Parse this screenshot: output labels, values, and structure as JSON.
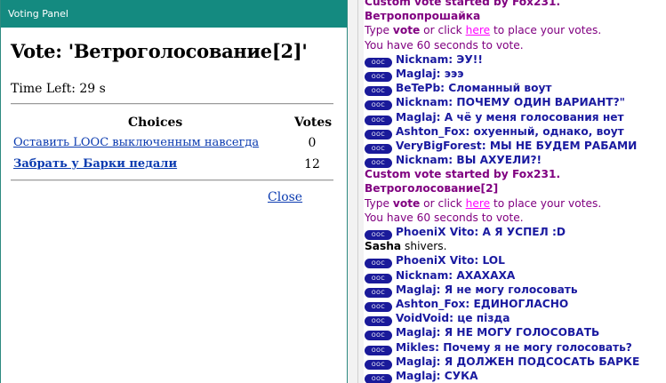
{
  "window": {
    "title": "Voting Panel"
  },
  "vote": {
    "title": "Vote: 'Ветроголосование[2]'",
    "time_left": "Time Left: 29 s",
    "col_choices": "Choices",
    "col_votes": "Votes",
    "choices": [
      {
        "label": "Оставить LOOC выключенным навсегда",
        "votes": "0"
      },
      {
        "label": "Забрать у Барки педали",
        "votes": "12"
      }
    ],
    "close_label": "Close"
  },
  "chat": {
    "badge_label": "OOC",
    "lines": [
      {
        "kind": "syshead",
        "text": "Custom vote started by Fox231."
      },
      {
        "kind": "syshead",
        "text": "Ветропопрошайка"
      },
      {
        "kind": "systype",
        "pre": "Type ",
        "bold": "vote",
        "mid": " or click ",
        "link": "here",
        "post": " to place your votes."
      },
      {
        "kind": "sys",
        "text": "You have 60 seconds to vote."
      },
      {
        "kind": "ooc",
        "text": "Nicknam: ЭУ!!"
      },
      {
        "kind": "ooc",
        "text": "Maglaj: эээ"
      },
      {
        "kind": "ooc",
        "text": "BeTePb: Сломанный воут"
      },
      {
        "kind": "ooc",
        "text": "Nicknam: ПОЧЕМУ ОДИН ВАРИАНТ?\""
      },
      {
        "kind": "ooc",
        "text": "Maglaj: А чё у меня голосования нет"
      },
      {
        "kind": "ooc",
        "text": "Ashton_Fox: охуенный, однако, воут"
      },
      {
        "kind": "ooc",
        "text": "VeryBigForest: МЫ НЕ БУДЕМ РАБАМИ"
      },
      {
        "kind": "ooc",
        "text": "Nicknam: ВЫ АХУЕЛИ?!"
      },
      {
        "kind": "syshead",
        "text": "Custom vote started by Fox231."
      },
      {
        "kind": "syshead",
        "text": "Ветроголосование[2]"
      },
      {
        "kind": "systype",
        "pre": "Type ",
        "bold": "vote",
        "mid": " or click ",
        "link": "here",
        "post": " to place your votes."
      },
      {
        "kind": "sys",
        "text": "You have 60 seconds to vote."
      },
      {
        "kind": "ooc",
        "text": "PhoeniX Vito: А Я УСПЕЛ :D"
      },
      {
        "kind": "emote",
        "name": "Sasha",
        "text": " shivers."
      },
      {
        "kind": "ooc",
        "text": "PhoeniX Vito: LOL"
      },
      {
        "kind": "ooc",
        "text": "Nicknam: АХАХАХА"
      },
      {
        "kind": "ooc",
        "text": "Maglaj: Я не могу голосовать"
      },
      {
        "kind": "ooc",
        "text": "Ashton_Fox: ЕДИНОГЛАСНО"
      },
      {
        "kind": "ooc",
        "text": "VoidVoid: це пізда"
      },
      {
        "kind": "ooc",
        "text": "Maglaj: Я НЕ МОГУ ГОЛОСОВАТЬ"
      },
      {
        "kind": "ooc",
        "text": "Mikles: Почему я не могу голосовать?"
      },
      {
        "kind": "ooc",
        "text": "Maglaj: Я ДОЛЖЕН ПОДСОСАТЬ БАРКЕ"
      },
      {
        "kind": "ooc",
        "text": "Maglaj: СУКА"
      }
    ]
  },
  "colors": {
    "titlebar": "#148a80",
    "link_blue": "#0b3bb0",
    "system_purple": "#800080",
    "chat_link": "#ff00ff",
    "ooc_blue": "#1a1aa0"
  }
}
